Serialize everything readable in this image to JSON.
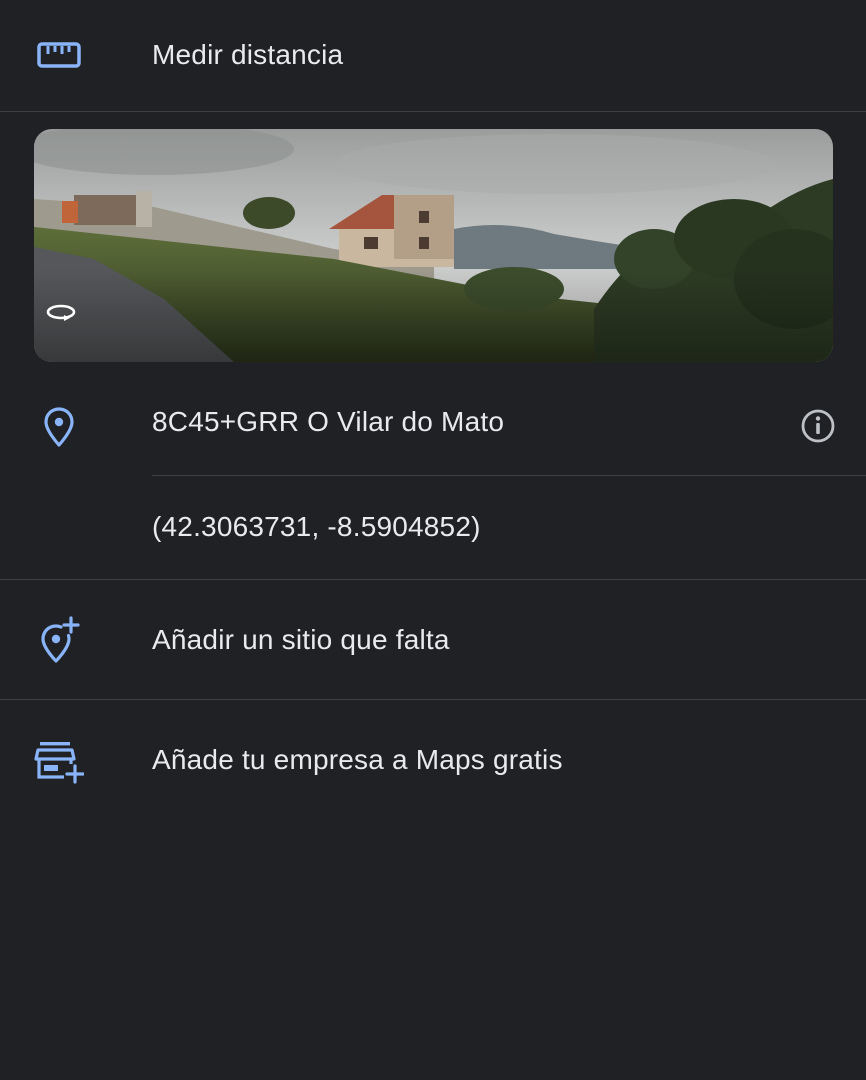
{
  "menu": {
    "measure_label": "Medir distancia",
    "measure_icon": "ruler-icon"
  },
  "place": {
    "plus_code_label": "8C45+GRR O Vilar do Mato",
    "coordinates": "(42.3063731, -8.5904852)",
    "pin_icon": "location-pin-icon",
    "info_icon": "info-icon",
    "street_view_icon": "street-view-360-icon"
  },
  "actions": {
    "add_missing_label": "Añadir un sitio que falta",
    "add_missing_icon": "add-location-icon",
    "add_business_label": "Añade tu empresa a Maps gratis",
    "add_business_icon": "add-business-icon"
  },
  "colors": {
    "background": "#202124",
    "text": "#e8eaed",
    "accent_icon": "#8ab4f8",
    "divider": "#3c4043"
  }
}
